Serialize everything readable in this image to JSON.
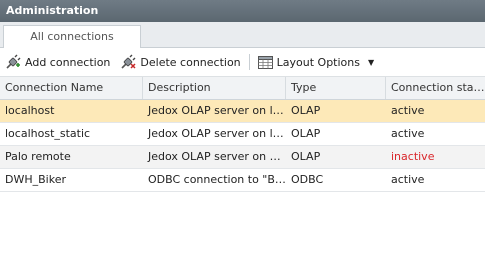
{
  "window": {
    "title": "Administration"
  },
  "tabs": [
    {
      "label": "All connections"
    }
  ],
  "toolbar": {
    "add_label": "Add connection",
    "delete_label": "Delete connection",
    "layout_label": "Layout Options"
  },
  "table": {
    "columns": [
      "Connection Name",
      "Description",
      "Type",
      "Connection stat..."
    ],
    "rows": [
      {
        "name": "localhost",
        "description": "Jedox OLAP server on loc...",
        "type": "OLAP",
        "status": "active",
        "selected": true
      },
      {
        "name": "localhost_static",
        "description": "Jedox OLAP server on loc...",
        "type": "OLAP",
        "status": "active",
        "selected": false
      },
      {
        "name": "Palo remote",
        "description": "Jedox OLAP server on srv...",
        "type": "OLAP",
        "status": "inactive",
        "selected": false
      },
      {
        "name": "DWH_Biker",
        "description": "ODBC connection to \"Bik...",
        "type": "ODBC",
        "status": "active",
        "selected": false
      }
    ]
  },
  "colors": {
    "titlebar": "#5b6770",
    "selected_row": "#fde9b8",
    "inactive_status": "#d9262b"
  }
}
